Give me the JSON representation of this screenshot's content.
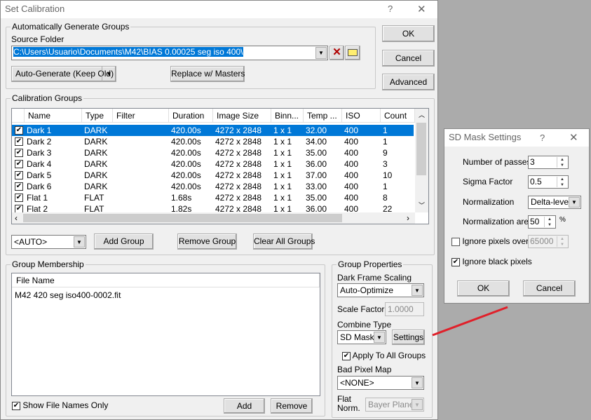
{
  "main_dialog": {
    "title": "Set Calibration",
    "help": "?",
    "close": "✕",
    "auto_group": {
      "title": "Automatically Generate Groups",
      "source_label": "Source Folder",
      "source_value": "C:\\Users\\Usuario\\Documents\\M42\\BIAS 0.00025 seg iso 400\\",
      "auto_generate": "Auto-Generate (Keep Old)",
      "replace": "Replace w/ Masters"
    },
    "ok": "OK",
    "cancel": "Cancel",
    "advanced": "Advanced",
    "cal_groups": {
      "title": "Calibration Groups",
      "columns": [
        "Name",
        "Type",
        "Filter",
        "Duration",
        "Image Size",
        "Binn...",
        "Temp ...",
        "ISO",
        "Count"
      ],
      "rows": [
        {
          "name": "Dark 1",
          "type": "DARK",
          "filter": "",
          "duration": "420.00s",
          "size": "4272 x 2848",
          "bin": "1 x 1",
          "temp": "32.00",
          "iso": "400",
          "count": "1",
          "checked": true,
          "selected": true
        },
        {
          "name": "Dark 2",
          "type": "DARK",
          "filter": "",
          "duration": "420.00s",
          "size": "4272 x 2848",
          "bin": "1 x 1",
          "temp": "34.00",
          "iso": "400",
          "count": "1",
          "checked": true
        },
        {
          "name": "Dark 3",
          "type": "DARK",
          "filter": "",
          "duration": "420.00s",
          "size": "4272 x 2848",
          "bin": "1 x 1",
          "temp": "35.00",
          "iso": "400",
          "count": "9",
          "checked": true
        },
        {
          "name": "Dark 4",
          "type": "DARK",
          "filter": "",
          "duration": "420.00s",
          "size": "4272 x 2848",
          "bin": "1 x 1",
          "temp": "36.00",
          "iso": "400",
          "count": "3",
          "checked": true
        },
        {
          "name": "Dark 5",
          "type": "DARK",
          "filter": "",
          "duration": "420.00s",
          "size": "4272 x 2848",
          "bin": "1 x 1",
          "temp": "37.00",
          "iso": "400",
          "count": "10",
          "checked": true
        },
        {
          "name": "Dark 6",
          "type": "DARK",
          "filter": "",
          "duration": "420.00s",
          "size": "4272 x 2848",
          "bin": "1 x 1",
          "temp": "33.00",
          "iso": "400",
          "count": "1",
          "checked": true
        },
        {
          "name": "Flat 1",
          "type": "FLAT",
          "filter": "",
          "duration": "1.68s",
          "size": "4272 x 2848",
          "bin": "1 x 1",
          "temp": "35.00",
          "iso": "400",
          "count": "8",
          "checked": true
        },
        {
          "name": "Flat 2",
          "type": "FLAT",
          "filter": "",
          "duration": "1.82s",
          "size": "4272 x 2848",
          "bin": "1 x 1",
          "temp": "36.00",
          "iso": "400",
          "count": "22",
          "checked": true
        }
      ],
      "auto_select": "<AUTO>",
      "add_group": "Add Group",
      "remove_group": "Remove Group",
      "clear_all": "Clear All Groups"
    },
    "membership": {
      "title": "Group Membership",
      "column": "File Name",
      "files": [
        "M42 420 seg iso400-0002.fit"
      ],
      "show_names_only": "Show File Names Only",
      "add": "Add",
      "remove": "Remove"
    },
    "properties": {
      "title": "Group Properties",
      "dark_scaling_label": "Dark Frame Scaling",
      "dark_scaling_value": "Auto-Optimize",
      "scale_factor_label": "Scale Factor",
      "scale_factor_value": "1.0000",
      "combine_label": "Combine Type",
      "combine_value": "SD Mask",
      "settings": "Settings",
      "apply_all": "Apply To All Groups",
      "bad_pixel_label": "Bad Pixel Map",
      "bad_pixel_value": "<NONE>",
      "flat_norm_label_1": "Flat",
      "flat_norm_label_2": "Norm.",
      "flat_norm_value": "Bayer Planes"
    }
  },
  "sd_mask": {
    "title": "SD Mask Settings",
    "help": "?",
    "close": "✕",
    "passes_label": "Number of passes",
    "passes_value": "3",
    "sigma_label": "Sigma Factor",
    "sigma_value": "0.5",
    "norm_label": "Normalization",
    "norm_value": "Delta-level",
    "area_label": "Normalization area",
    "area_value": "50",
    "area_unit": "%",
    "ignore_over_label": "Ignore pixels over",
    "ignore_over_value": "65000",
    "ignore_over_checked": false,
    "ignore_black_label": "Ignore black pixels",
    "ignore_black_checked": true,
    "ok": "OK",
    "cancel": "Cancel"
  },
  "colors": {
    "selection": "#0078d7",
    "arrow": "#e0202a"
  }
}
